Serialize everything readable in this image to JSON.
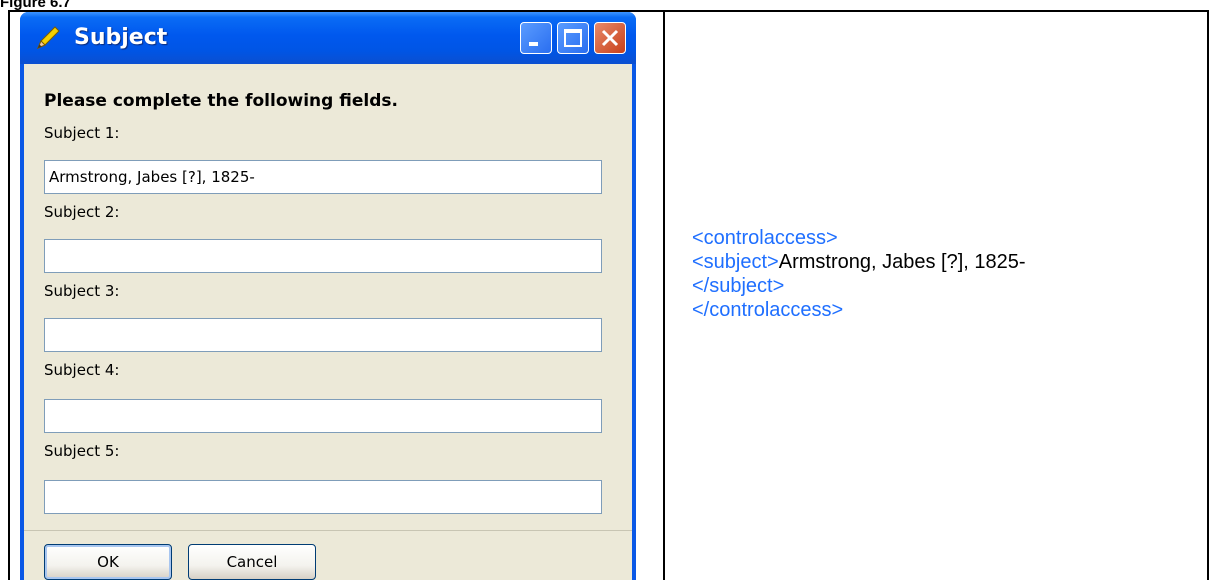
{
  "figure_label": "Figure 6.7",
  "window": {
    "title": "Subject",
    "icon": "pencil-icon",
    "controls": [
      "minimize-icon",
      "maximize-icon",
      "close-icon"
    ]
  },
  "form": {
    "heading": "Please complete the following fields.",
    "fields": [
      {
        "label": "Subject 1:",
        "value": "Armstrong, Jabes [?], 1825-"
      },
      {
        "label": "Subject 2:",
        "value": ""
      },
      {
        "label": "Subject 3:",
        "value": ""
      },
      {
        "label": "Subject 4:",
        "value": ""
      },
      {
        "label": "Subject 5:",
        "value": ""
      }
    ],
    "ok_label": "OK",
    "cancel_label": "Cancel"
  },
  "xml": {
    "open_controlaccess": "<controlaccess>",
    "open_subject": "<subject>",
    "subject_text": "Armstrong, Jabes [?], 1825-",
    "close_subject": "</subject>",
    "close_controlaccess": "</controlaccess>"
  },
  "colors": {
    "xml_tag": "#1f6fff",
    "titlebar": "#0055e5",
    "dialog_bg": "#ece9d8"
  }
}
